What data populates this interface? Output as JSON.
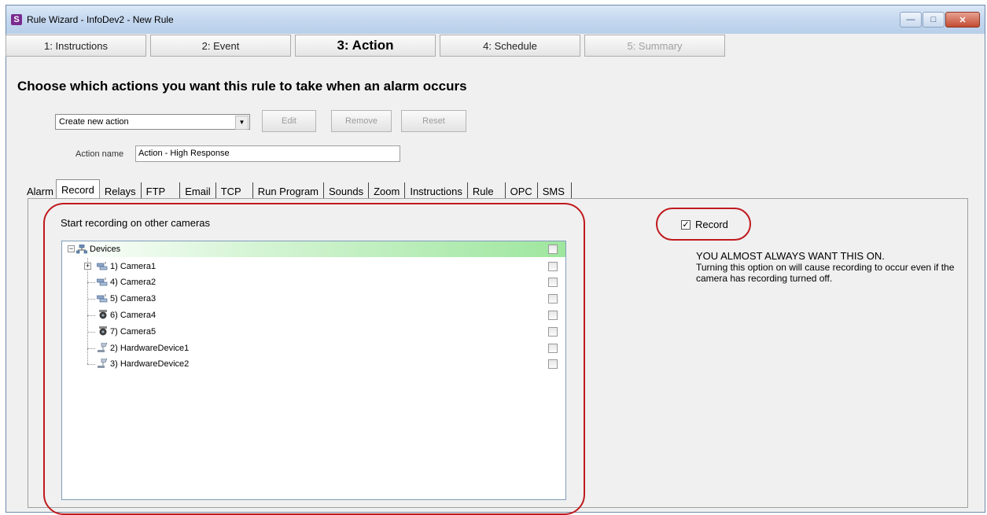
{
  "window": {
    "title": "Rule Wizard - InfoDev2 - New Rule",
    "app_icon_letter": "S"
  },
  "steps": [
    {
      "label": "1: Instructions",
      "state": "normal"
    },
    {
      "label": "2: Event",
      "state": "normal"
    },
    {
      "label": "3: Action",
      "state": "active"
    },
    {
      "label": "4: Schedule",
      "state": "normal"
    },
    {
      "label": "5: Summary",
      "state": "disabled"
    }
  ],
  "heading": "Choose which actions you want this rule to take when an alarm occurs",
  "action_select": {
    "value": "Create new action"
  },
  "buttons": {
    "edit": "Edit",
    "remove": "Remove",
    "reset": "Reset"
  },
  "action_name": {
    "label": "Action name",
    "value": "Action - High Response"
  },
  "tabs": [
    "Alarm",
    "Record",
    "Relays",
    "FTP",
    "Email",
    "TCP",
    "Run Program",
    "Sounds",
    "Zoom",
    "Instructions",
    "Rule",
    "OPC",
    "SMS"
  ],
  "active_tab": "Record",
  "record_panel": {
    "section_label": "Start recording on other cameras",
    "tree": {
      "root": "Devices",
      "items": [
        {
          "label": "1) Camera1",
          "icon": "camera-group-icon",
          "expandable": true
        },
        {
          "label": "4) Camera2",
          "icon": "camera-group-icon",
          "expandable": false
        },
        {
          "label": "5) Camera3",
          "icon": "camera-group-icon",
          "expandable": false
        },
        {
          "label": "6) Camera4",
          "icon": "dome-camera-icon",
          "expandable": false
        },
        {
          "label": "7) Camera5",
          "icon": "dome-camera-icon",
          "expandable": false
        },
        {
          "label": "2) HardwareDevice1",
          "icon": "hardware-device-icon",
          "expandable": false
        },
        {
          "label": "3) HardwareDevice2",
          "icon": "hardware-device-icon",
          "expandable": false
        }
      ]
    },
    "record_checkbox": {
      "label": "Record",
      "checked": true
    },
    "note_heading": "YOU ALMOST ALWAYS WANT THIS ON.",
    "note_body": "Turning this option on will cause recording to occur even if the camera has recording turned off."
  },
  "colors": {
    "highlight_oval": "#c0191d",
    "tree_header_green": "#9ee69e"
  }
}
